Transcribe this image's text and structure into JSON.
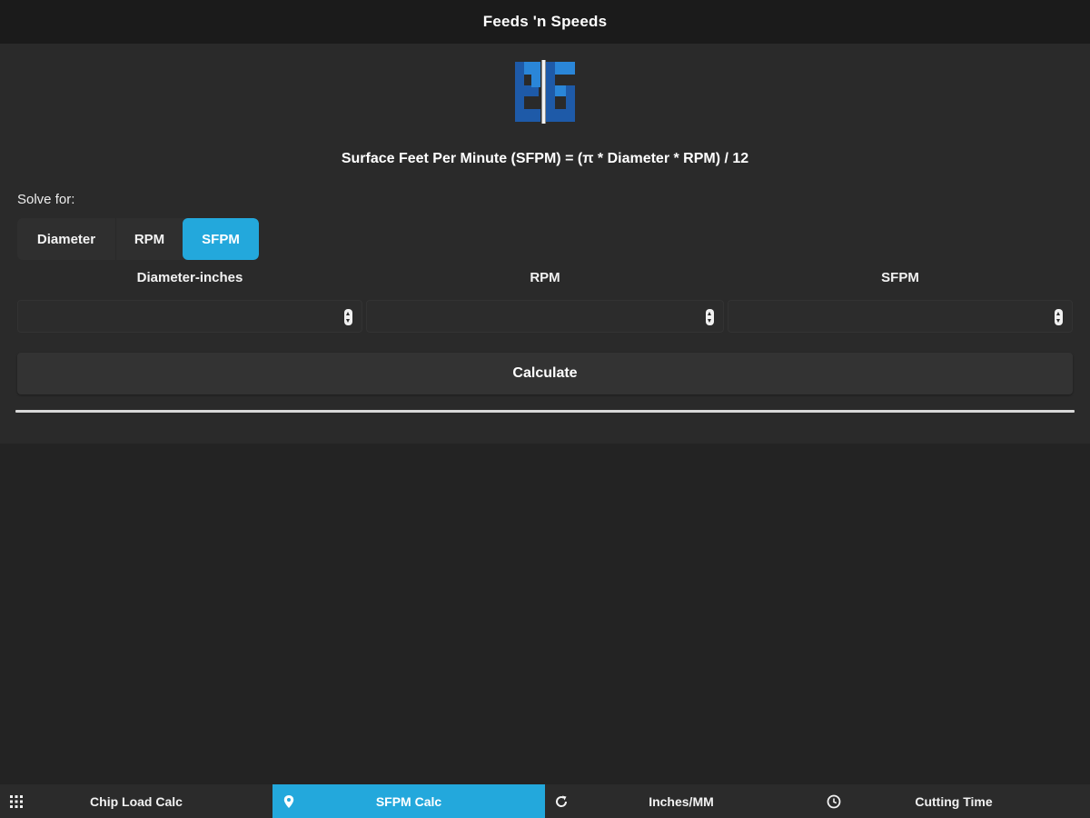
{
  "header": {
    "title": "Feeds 'n Speeds"
  },
  "formula": "Surface Feet Per Minute (SFPM) = (π * Diameter * RPM) / 12",
  "solve_for": {
    "label": "Solve for:",
    "options": [
      "Diameter",
      "RPM",
      "SFPM"
    ],
    "selected": "SFPM"
  },
  "fields": [
    {
      "label": "Diameter-inches",
      "value": ""
    },
    {
      "label": "RPM",
      "value": ""
    },
    {
      "label": "SFPM",
      "value": ""
    }
  ],
  "calculate_label": "Calculate",
  "tabs": [
    {
      "label": "Chip Load Calc",
      "icon": "grid-icon",
      "active": false
    },
    {
      "label": "SFPM Calc",
      "icon": "location-pin-icon",
      "active": true
    },
    {
      "label": "Inches/MM",
      "icon": "refresh-icon",
      "active": false
    },
    {
      "label": "Cutting Time",
      "icon": "clock-icon",
      "active": false
    }
  ],
  "colors": {
    "accent": "#23a8dc",
    "logo_dark_blue": "#1e5aa8",
    "logo_light_blue": "#2a86d8",
    "background": "#232323"
  }
}
